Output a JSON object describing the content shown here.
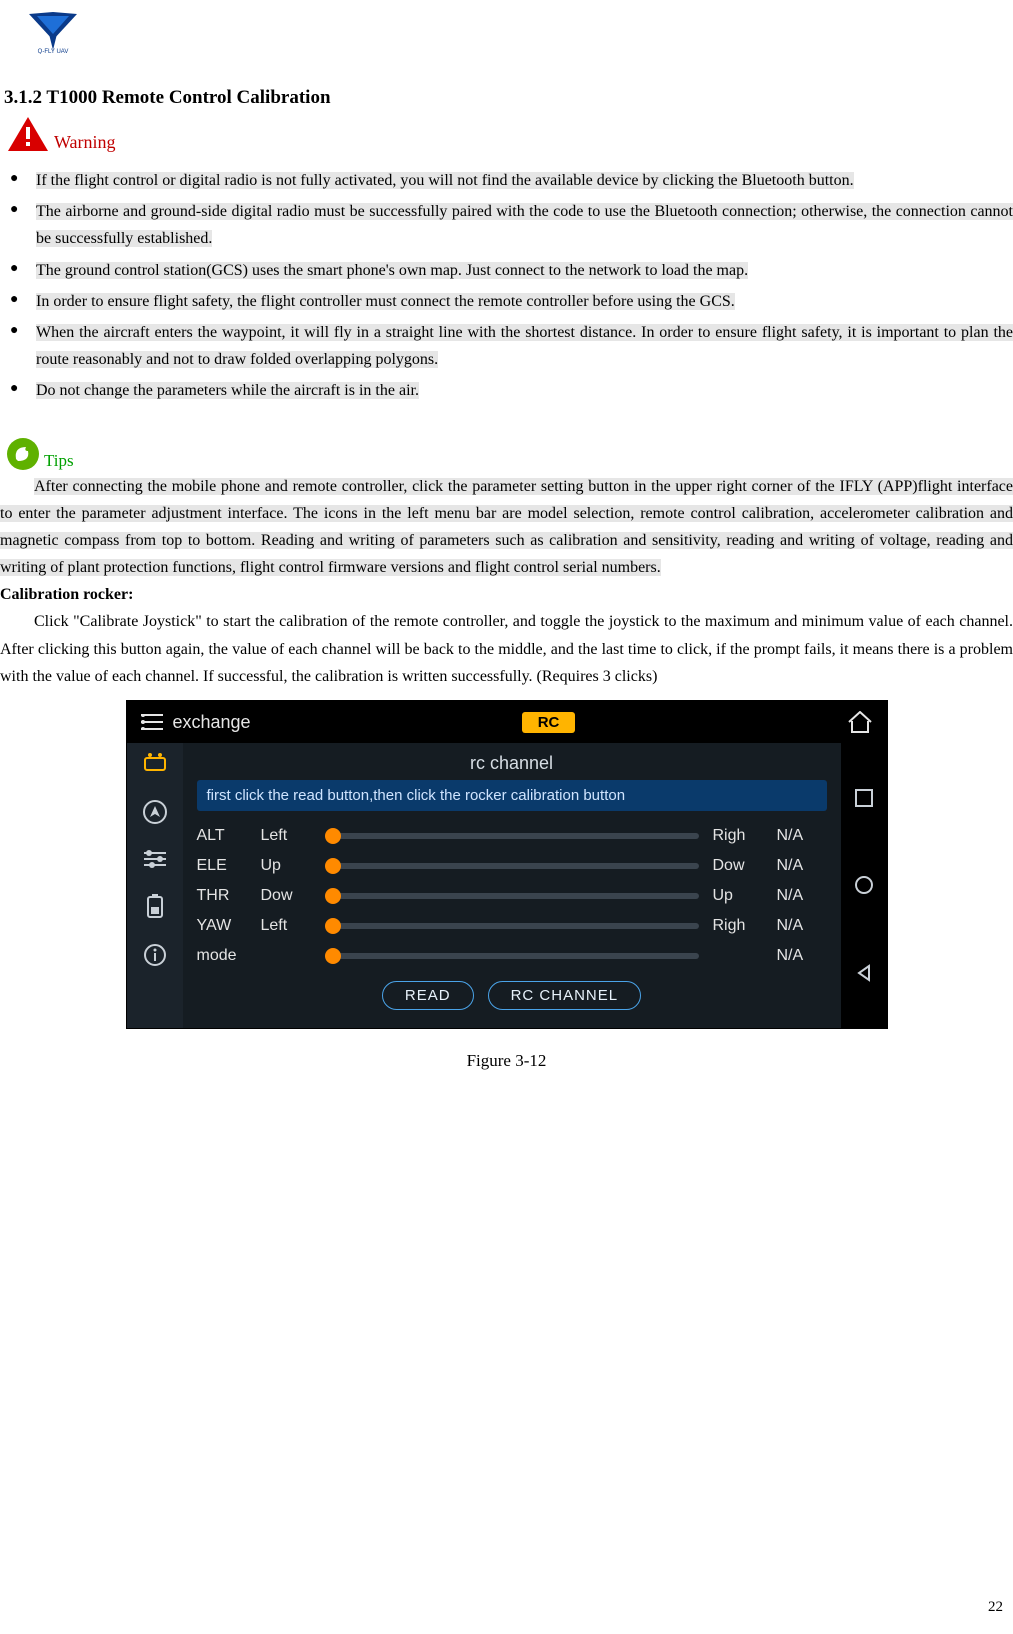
{
  "brand": "Q-FLY UAV",
  "heading": "3.1.2    T1000 Remote Control Calibration",
  "warning_label": "Warning",
  "warnings": [
    "If the flight control or digital radio is not fully activated, you will not find the available device by clicking the Bluetooth button.",
    "The airborne and ground-side digital radio must be successfully paired with the code to use the Bluetooth connection; otherwise, the connection cannot be successfully established.",
    "The ground control station(GCS) uses the smart phone's own map. Just connect to the network to load the map.",
    "In order to ensure flight safety, the flight controller must connect the remote controller before using the GCS.",
    "When the aircraft enters the waypoint, it will fly in a straight line with the shortest distance. In order to ensure flight safety, it is important to plan the route reasonably and not to draw folded overlapping polygons.",
    "Do not change the parameters while the aircraft is in the air."
  ],
  "tips_label": "Tips",
  "tips_para": "After connecting the mobile phone and remote controller, click the parameter setting button in the upper right corner of the IFLY (APP)flight interface to enter the parameter adjustment interface. The icons in the left menu bar are model selection, remote control calibration, accelerometer calibration and magnetic compass from top to bottom. Reading and writing of parameters such as calibration and sensitivity, reading and writing of voltage, reading and writing of plant protection functions, flight control firmware versions and flight control serial numbers.",
  "calib_heading": "Calibration rocker:",
  "calib_para": "Click \"Calibrate Joystick\" to start the calibration of the remote controller, and toggle the joystick to the maximum and minimum value of each channel. After clicking this button again, the value of each channel will be back to the middle, and the last time to click, if the prompt fails, it means there is a problem with the value of each channel. If successful, the calibration is written successfully. (Requires 3 clicks)",
  "figure": {
    "topbar_left": "exchange",
    "rc_label": "RC",
    "panel_title": "rc channel",
    "hint": "first click the read button,then click the rocker calibration button",
    "channels": [
      {
        "name": "ALT",
        "dir": "Left",
        "right": "Righ",
        "na": "N/A"
      },
      {
        "name": "ELE",
        "dir": "Up",
        "right": "Dow",
        "na": "N/A"
      },
      {
        "name": "THR",
        "dir": "Dow",
        "right": "Up",
        "na": "N/A"
      },
      {
        "name": "YAW",
        "dir": "Left",
        "right": "Righ",
        "na": "N/A"
      },
      {
        "name": "mode",
        "dir": "",
        "right": "",
        "na": "N/A"
      }
    ],
    "read_btn": "READ",
    "channel_btn": "RC CHANNEL",
    "caption": "Figure 3-12"
  },
  "page_number": "22"
}
